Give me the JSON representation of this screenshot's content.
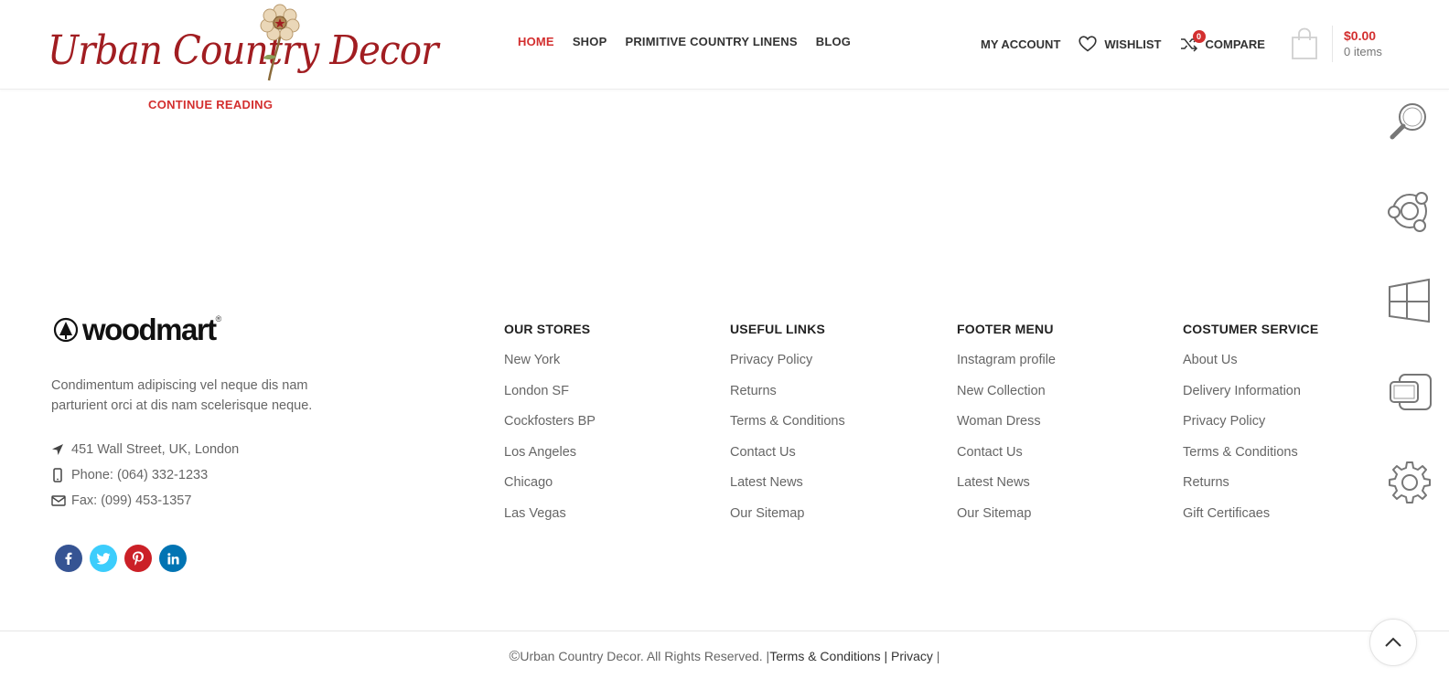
{
  "brand": {
    "name": "Urban Country Decor"
  },
  "nav": {
    "items": [
      {
        "label": "HOME",
        "active": true
      },
      {
        "label": "SHOP",
        "active": false
      },
      {
        "label": "PRIMITIVE COUNTRY LINENS",
        "active": false
      },
      {
        "label": "BLOG",
        "active": false
      }
    ]
  },
  "header_right": {
    "my_account": "MY ACCOUNT",
    "wishlist": "WISHLIST",
    "compare": "COMPARE",
    "compare_count": "0"
  },
  "cart": {
    "total": "$0.00",
    "items": "0 items"
  },
  "post": {
    "continue_reading": "CONTINUE READING"
  },
  "sidebar_tools": [
    "search-icon",
    "support-icon",
    "windows-icon",
    "device-icon",
    "gear-icon"
  ],
  "footer": {
    "logo_text": "woodmart",
    "about": "Condimentum adipiscing vel neque dis nam parturient orci at dis nam scelerisque neque.",
    "address": "451 Wall Street, UK, London",
    "phone": "Phone: (064) 332-1233",
    "fax": "Fax: (099) 453-1357",
    "social": [
      {
        "icon": "facebook-icon",
        "glyph": "f",
        "color": "#365493"
      },
      {
        "icon": "twitter-icon",
        "glyph": "t",
        "color": "#3ccdfc"
      },
      {
        "icon": "pinterest-icon",
        "glyph": "p",
        "color": "#cb2027"
      },
      {
        "icon": "linkedin-icon",
        "glyph": "in",
        "color": "#0274b3"
      }
    ],
    "columns": [
      {
        "title": "OUR STORES",
        "links": [
          "New York",
          "London SF",
          "Cockfosters BP",
          "Los Angeles",
          "Chicago",
          "Las Vegas"
        ]
      },
      {
        "title": "USEFUL LINKS",
        "links": [
          "Privacy Policy",
          "Returns",
          "Terms & Conditions",
          "Contact Us",
          "Latest News",
          "Our Sitemap"
        ]
      },
      {
        "title": "FOOTER MENU",
        "links": [
          "Instagram profile",
          "New Collection",
          "Woman Dress",
          "Contact Us",
          "Latest News",
          "Our Sitemap"
        ]
      },
      {
        "title": "COSTUMER SERVICE",
        "links": [
          "About Us",
          "Delivery Information",
          "Privacy Policy",
          "Terms & Conditions",
          "Returns",
          "Gift Certificaes"
        ]
      }
    ],
    "copyright": {
      "symbol": "©",
      "text": "Urban Country Decor. All Rights Reserved. |",
      "terms": "Terms & Conditions",
      "sep": " | ",
      "privacy": "Privacy",
      "tail": " |"
    }
  },
  "colors": {
    "accent": "#d32f2f",
    "logo_red": "#a11d21"
  }
}
